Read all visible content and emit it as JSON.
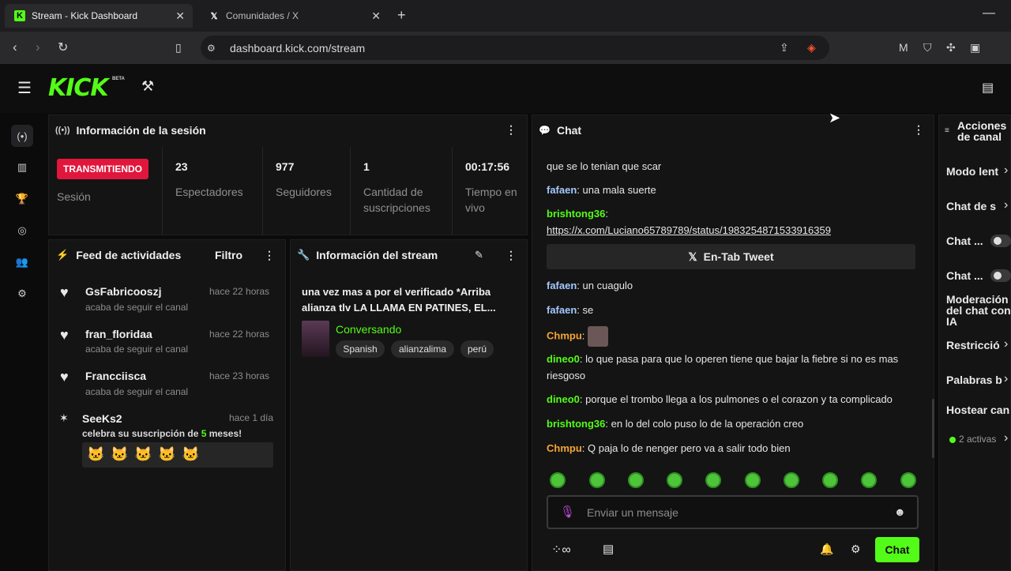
{
  "browser": {
    "tabs": [
      {
        "title": "Stream - Kick Dashboard",
        "icon": "kick-icon"
      },
      {
        "title": "Comunidades / X",
        "icon": "x-icon"
      }
    ],
    "url": "dashboard.kick.com/stream"
  },
  "app": {
    "logo": "KICK",
    "beta": "BETA",
    "accent": "#53fc18"
  },
  "session": {
    "title": "Información de la sesión",
    "status_badge": "TRANSMITIENDO",
    "status_label": "Sesión",
    "stats": [
      {
        "value": "23",
        "label": "Espectadores"
      },
      {
        "value": "977",
        "label": "Seguidores"
      },
      {
        "value": "1",
        "label": "Cantidad de suscripciones"
      },
      {
        "value": "00:17:56",
        "label": "Tiempo en vivo"
      }
    ]
  },
  "feed": {
    "title": "Feed de actividades",
    "filter": "Filtro",
    "items": [
      {
        "name": "GsFabricooszj",
        "sub": "acaba de seguir el canal",
        "time": "hace 22 horas"
      },
      {
        "name": "fran_floridaa",
        "sub": "acaba de seguir el canal",
        "time": "hace 22 horas"
      },
      {
        "name": "Francciisca",
        "sub": "acaba de seguir el canal",
        "time": "hace 23 horas"
      }
    ],
    "sub_item": {
      "name": "SeeKs2",
      "time": "hace 1 día",
      "text_pre": "celebra su suscripción de ",
      "months": "5",
      "text_post": " meses!"
    }
  },
  "stream_info": {
    "title": "Información del stream",
    "stream_title": "una vez mas a por el verificado *Arriba alianza tlv LA LLAMA EN PATINES, EL...",
    "category": "Conversando",
    "tags": [
      "Spanish",
      "alianzalima",
      "perú"
    ]
  },
  "chat": {
    "title": "Chat",
    "messages": [
      {
        "user": "",
        "text": "que se lo tenian que scar"
      },
      {
        "user": "fafaen",
        "color": "#a5c8ff",
        "text": "una mala suerte"
      },
      {
        "user": "brishtong36",
        "color": "#53fc18",
        "text": ""
      },
      {
        "user": "",
        "text": "https://x.com/Luciano65789789/status/1983254871533916359"
      },
      {
        "user": "fafaen",
        "color": "#a5c8ff",
        "text": "un cuagulo"
      },
      {
        "user": "fafaen",
        "color": "#a5c8ff",
        "text": "se"
      },
      {
        "user": "Chmpu",
        "color": "#f6a432",
        "text": ""
      },
      {
        "user": "dineo0",
        "color": "#53fc18",
        "text": "lo que pasa para que lo operen tiene que bajar la fiebre si no es mas riesgoso"
      },
      {
        "user": "dineo0",
        "color": "#53fc18",
        "text": "porque el trombo llega a los pulmones o el corazon y ta complicado"
      },
      {
        "user": "brishtong36",
        "color": "#53fc18",
        "text": "en lo del colo puso lo de la operación creo"
      },
      {
        "user": "Chmpu",
        "color": "#f6a432",
        "text": "Q paja lo de nenger pero va a salir todo bien"
      }
    ],
    "tweet_button": "En-Tab Tweet",
    "input_placeholder": "Enviar un mensaje",
    "send_label": "Chat"
  },
  "channel_actions": {
    "title": "Acciones de canal",
    "items": [
      "Modo lent",
      "Chat de s",
      "Chat ...",
      "Chat ...",
      "Moderación del chat con IA",
      "Restricció",
      "Palabras b",
      "Hostear can"
    ],
    "active_count": "2 activas"
  }
}
